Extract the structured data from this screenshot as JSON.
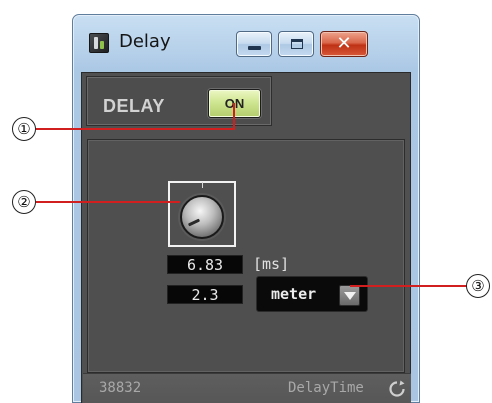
{
  "window": {
    "title": "Delay",
    "icon": "delay-component-icon"
  },
  "controls": {
    "minimize_icon": "minimize-icon",
    "maximize_icon": "maximize-icon",
    "close_glyph": "✕"
  },
  "section": {
    "label": "DELAY",
    "on_button_label": "ON"
  },
  "delay": {
    "knob_icon": "knob-icon",
    "time_value": "6.83",
    "time_unit": "[ms]",
    "distance_value": "2.3",
    "distance_unit": "meter"
  },
  "status_bar": {
    "id": "38832",
    "parameter": "DelayTime",
    "refresh_icon": "refresh-icon"
  },
  "callouts": [
    "①",
    "②",
    "③"
  ],
  "colors": {
    "callout_line": "#d11f1f",
    "on_button": "#cfe692",
    "panel_bg": "#505050"
  }
}
